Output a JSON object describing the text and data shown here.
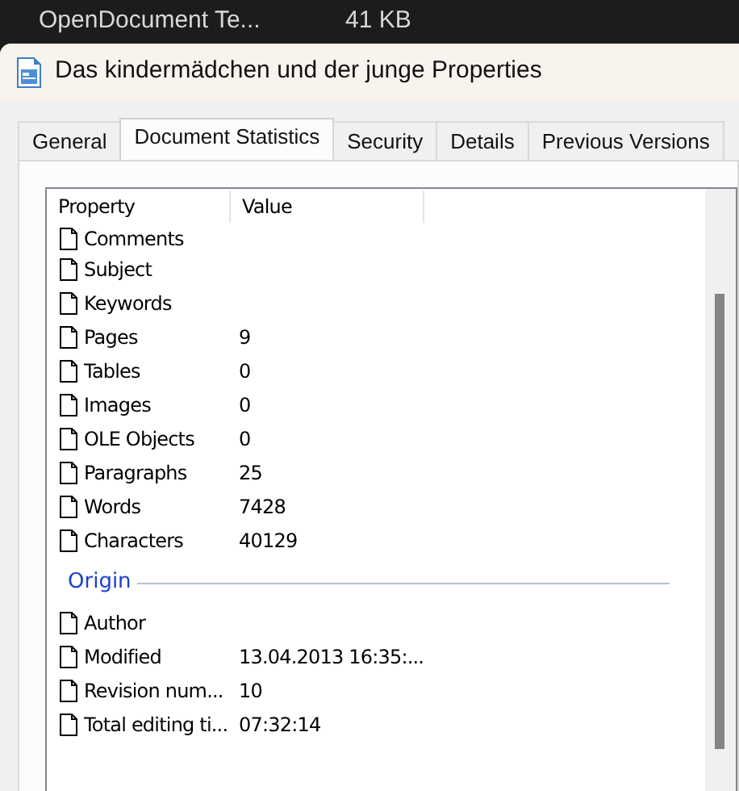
{
  "background_item": {
    "name": "OpenDocument Te...",
    "size": "41 KB"
  },
  "window": {
    "title": "Das kindermädchen und der junge Properties"
  },
  "tabs": [
    {
      "label": "General",
      "selected": false
    },
    {
      "label": "Document Statistics",
      "selected": true
    },
    {
      "label": "Security",
      "selected": false
    },
    {
      "label": "Details",
      "selected": false
    },
    {
      "label": "Previous Versions",
      "selected": false
    }
  ],
  "list": {
    "columns": [
      "Property",
      "Value"
    ],
    "items": [
      {
        "kind": "row",
        "property": "Comments"
      },
      {
        "kind": "row",
        "property": "Subject"
      },
      {
        "kind": "row",
        "property": "Keywords"
      },
      {
        "kind": "row",
        "property": "Pages",
        "value": "9"
      },
      {
        "kind": "row",
        "property": "Tables",
        "value": "0"
      },
      {
        "kind": "row",
        "property": "Images",
        "value": "0"
      },
      {
        "kind": "row",
        "property": "OLE Objects",
        "value": "0"
      },
      {
        "kind": "row",
        "property": "Paragraphs",
        "value": "25"
      },
      {
        "kind": "row",
        "property": "Words",
        "value": "7428"
      },
      {
        "kind": "row",
        "property": "Characters",
        "value": "40129"
      },
      {
        "kind": "group",
        "property": "Origin"
      },
      {
        "kind": "row",
        "property": "Author"
      },
      {
        "kind": "row",
        "property": "Modified",
        "value": "13.04.2013 16:35:..."
      },
      {
        "kind": "row",
        "property": "Revision num...",
        "value": "10"
      },
      {
        "kind": "row",
        "property": "Total editing ti...",
        "value": "07:32:14"
      }
    ]
  }
}
